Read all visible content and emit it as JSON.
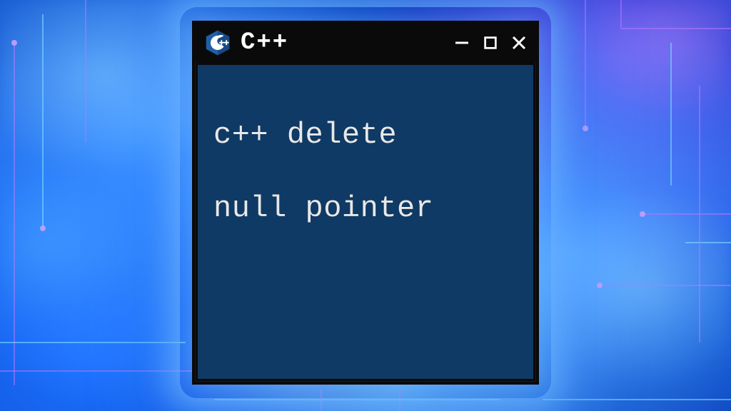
{
  "window": {
    "title": "C++",
    "icon_name": "cpp-logo",
    "content_line1": "c++ delete",
    "content_line2": "null pointer",
    "colors": {
      "titlebar_bg": "#0a0a0a",
      "client_bg": "#0f3a66",
      "text": "#e8e8e8",
      "logo_hex": "#1f5fa8"
    }
  }
}
